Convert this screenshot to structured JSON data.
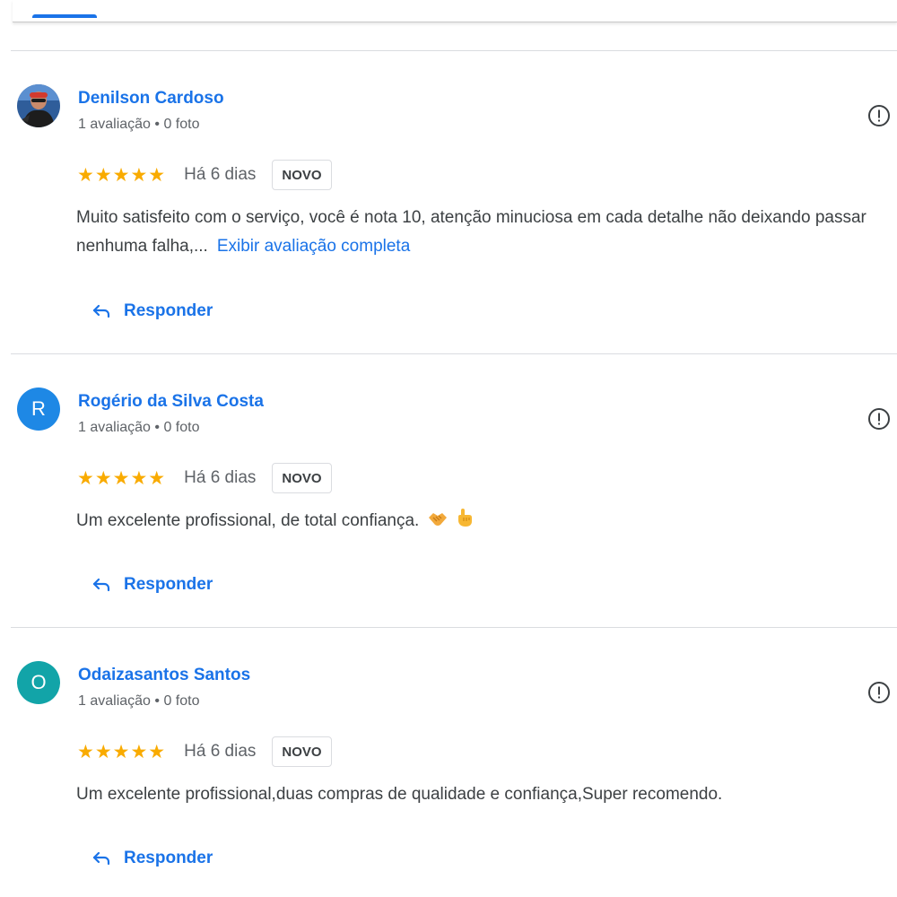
{
  "reviews": [
    {
      "name": "Denilson Cardoso",
      "meta": "1 avaliação • 0 foto",
      "avatar_letter": "",
      "avatar_color": "#3a5a8c",
      "stars": "★★★★★",
      "rating": 5,
      "date": "Há 6 dias",
      "badge": "NOVO",
      "text": "Muito satisfeito com o serviço, você é nota 10, atenção minuciosa em cada detalhe não deixando passar nenhuma falha,...",
      "more_link": "Exibir avaliação completa",
      "reply_label": "Responder"
    },
    {
      "name": "Rogério da Silva Costa",
      "meta": "1 avaliação • 0 foto",
      "avatar_letter": "R",
      "avatar_color": "#1e88e5",
      "stars": "★★★★★",
      "rating": 5,
      "date": "Há 6 dias",
      "badge": "NOVO",
      "text": "Um excelente profissional, de total confiança.",
      "emoji_icons": [
        "handshake-icon",
        "pointing-hand-icon"
      ],
      "reply_label": "Responder"
    },
    {
      "name": "Odaizasantos Santos",
      "meta": "1 avaliação • 0 foto",
      "avatar_letter": "O",
      "avatar_color": "#12a4a8",
      "stars": "★★★★★",
      "rating": 5,
      "date": "Há 6 dias",
      "badge": "NOVO",
      "text": "Um excelente profissional,duas compras de qualidade e confiança,Super recomendo.",
      "reply_label": "Responder"
    }
  ],
  "colors": {
    "accent": "#1a73e8",
    "star": "#f9ab00",
    "text": "#3c4043",
    "secondary": "#5f6368",
    "divider": "#dadce0"
  }
}
